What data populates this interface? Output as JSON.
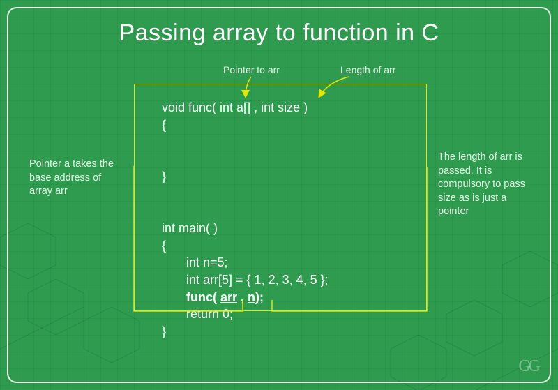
{
  "title": "Passing array to function in C",
  "annotations": {
    "pointer_to_arr": "Pointer to arr",
    "length_of_arr": "Length of arr",
    "left_note": "Pointer a takes the base address of array arr",
    "right_note": "The length of arr is passed. It is compulsory to pass size as is just a pointer"
  },
  "code": {
    "line1": "void func( int a[] , int size )",
    "line2": "{",
    "line3": "}",
    "line4": "int main( )",
    "line5": "{",
    "line6": "       int n=5;",
    "line7": "       int arr[5] = { 1, 2, 3, 4, 5 };",
    "line8_pre": "       func( ",
    "line8_arr": "arr",
    "line8_mid": " , ",
    "line8_n": "n",
    "line8_post": ");",
    "line9": "       return 0;",
    "line10": "}"
  },
  "logo": "GG"
}
